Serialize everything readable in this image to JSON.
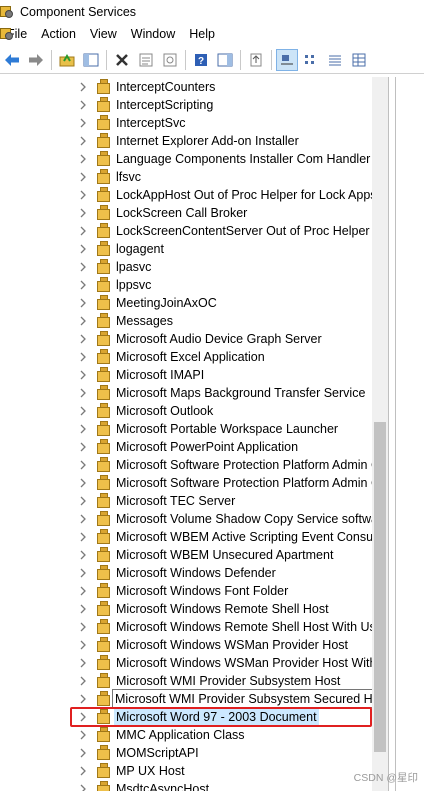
{
  "window": {
    "title": "Component Services"
  },
  "menu": [
    "File",
    "Action",
    "View",
    "Window",
    "Help"
  ],
  "toolbar": {
    "buttons": [
      "back-arrow-icon",
      "forward-arrow-icon",
      "up-folder-icon",
      "show-hide-tree-icon",
      "delete-icon",
      "properties-icon",
      "refresh-icon",
      "help-icon",
      "show-action-pane-icon",
      "export-icon",
      "large-icons-view-icon",
      "small-icons-view-icon",
      "list-view-icon",
      "detail-view-icon"
    ],
    "active_index": 10
  },
  "tree": {
    "items": [
      "InterceptCounters",
      "InterceptScripting",
      "InterceptSvc",
      "Internet Explorer Add-on Installer",
      "Language Components Installer Com Handler",
      "lfsvc",
      "LockAppHost Out of Proc Helper for Lock Apps",
      "LockScreen Call Broker",
      "LockScreenContentServer Out of Proc Helper for",
      "logagent",
      "lpasvc",
      "lppsvc",
      "MeetingJoinAxOC",
      "Messages",
      "Microsoft Audio Device Graph Server",
      "Microsoft Excel Application",
      "Microsoft IMAPI",
      "Microsoft Maps Background Transfer Service",
      "Microsoft Outlook",
      "Microsoft Portable Workspace Launcher",
      "Microsoft PowerPoint Application",
      "Microsoft Software Protection Platform Admin C",
      "Microsoft Software Protection Platform Admin C",
      "Microsoft TEC Server",
      "Microsoft Volume Shadow Copy Service software",
      "Microsoft WBEM Active Scripting Event Consum",
      "Microsoft WBEM Unsecured Apartment",
      "Microsoft Windows Defender",
      "Microsoft Windows Font Folder",
      "Microsoft Windows Remote Shell Host",
      "Microsoft Windows Remote Shell Host With User",
      "Microsoft Windows WSMan Provider Host",
      "Microsoft Windows WSMan Provider Host With U",
      "Microsoft WMI Provider Subsystem Host",
      "Microsoft WMI Provider Subsystem Secured Host",
      "Microsoft Word 97 - 2003 Document",
      "MMC Application Class",
      "MOMScriptAPI",
      "MP UX Host",
      "MsdtcAsyncHost"
    ],
    "selected_index": 35,
    "tooltip_index": 34
  },
  "watermark": "CSDN @星印"
}
